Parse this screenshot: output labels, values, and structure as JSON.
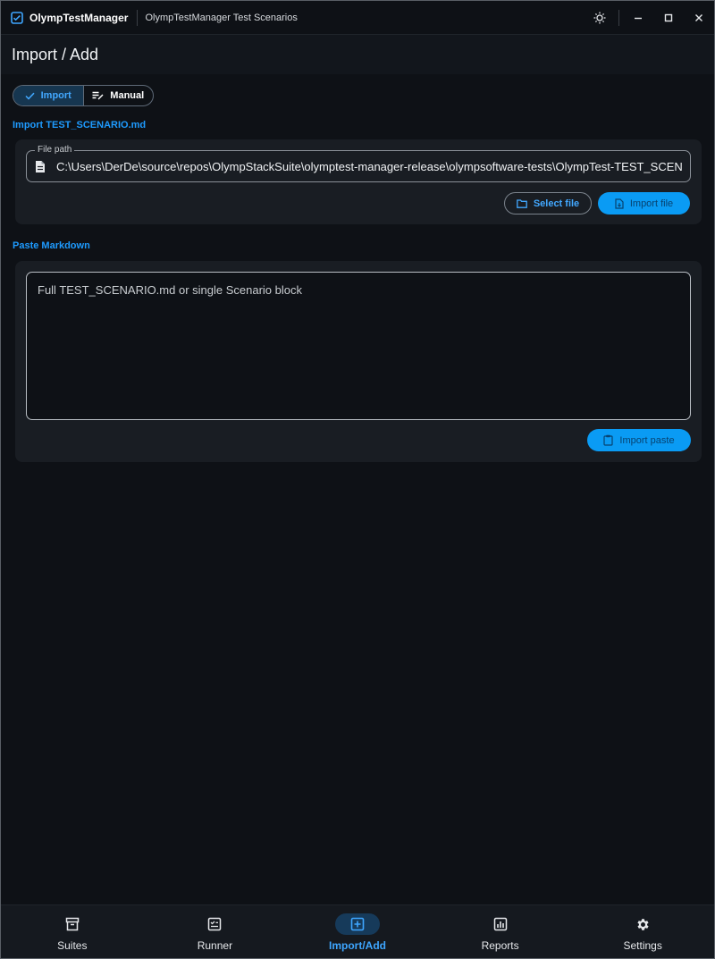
{
  "titlebar": {
    "app_name": "OlympTestManager",
    "window_title": "OlympTestManager Test Scenarios"
  },
  "header": {
    "title": "Import / Add"
  },
  "mode_toggle": {
    "options": [
      {
        "label": "Import",
        "icon": "check-icon",
        "selected": true
      },
      {
        "label": "Manual",
        "icon": "edit-list-icon",
        "selected": false
      }
    ]
  },
  "import_file": {
    "section_label": "Import TEST_SCENARIO.md",
    "file_path_legend": "File path",
    "file_path_value": "C:\\Users\\DerDe\\source\\repos\\OlympStackSuite\\olymptest-manager-release\\olympsoftware-tests\\OlympTest-TEST_SCEN...",
    "select_file_label": "Select file",
    "import_file_label": "Import file"
  },
  "paste": {
    "section_label": "Paste Markdown",
    "placeholder": "Full TEST_SCENARIO.md or single Scenario block",
    "import_paste_label": "Import paste"
  },
  "bottom_nav": {
    "items": [
      {
        "label": "Suites",
        "icon": "archive-icon",
        "active": false
      },
      {
        "label": "Runner",
        "icon": "checklist-icon",
        "active": false
      },
      {
        "label": "Import/Add",
        "icon": "plus-box-icon",
        "active": true
      },
      {
        "label": "Reports",
        "icon": "bar-chart-icon",
        "active": false
      },
      {
        "label": "Settings",
        "icon": "gear-icon",
        "active": false
      }
    ]
  },
  "colors": {
    "accent": "#1e9bff",
    "background": "#0e1116",
    "card": "#191d23",
    "primary_button": "#0a9bf4"
  }
}
